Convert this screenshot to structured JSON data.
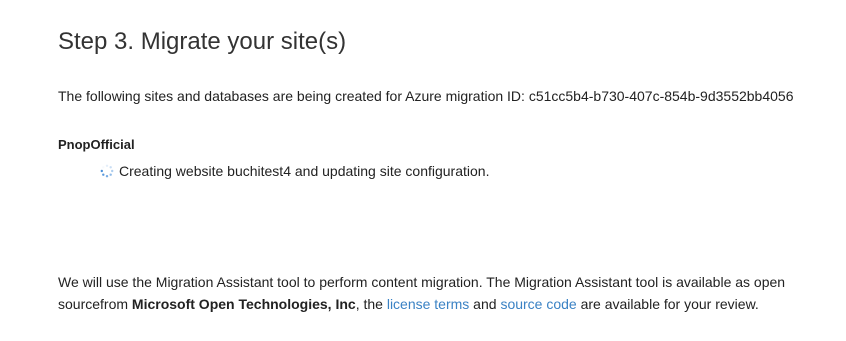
{
  "page": {
    "title": "Step 3. Migrate your site(s)",
    "intro": "The following sites and databases are being created for Azure migration ID: c51cc5b4-b730-407c-854b-9d3552bb4056"
  },
  "site": {
    "name": "PnopOfficial",
    "status_icon": "loading-spinner-icon",
    "status_text": "Creating website buchitest4 and updating site configuration."
  },
  "footer": {
    "text_1": "We will use the Migration Assistant tool to perform content migration. The Migration Assistant tool is available as open sourcefrom ",
    "org_name": "Microsoft Open Technologies, Inc",
    "text_2": ", the ",
    "license_link": "license terms",
    "text_3": " and ",
    "source_link": "source code",
    "text_4": " are available for your review."
  },
  "colors": {
    "link": "#3a82c4",
    "spinner": "#4a90d9",
    "text": "#222222"
  }
}
